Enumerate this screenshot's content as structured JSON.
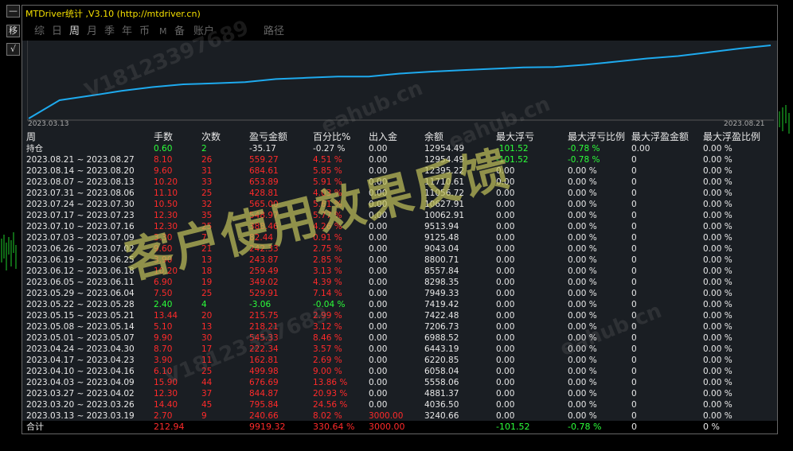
{
  "window": {
    "title": "MTDriver统计 ,V3.10 (http://mtdriver.cn)"
  },
  "side_buttons": [
    {
      "label": "—"
    },
    {
      "label": "移"
    },
    {
      "label": "√"
    }
  ],
  "tabs": [
    {
      "label": "综",
      "active": false
    },
    {
      "label": "日",
      "active": false
    },
    {
      "label": "周",
      "active": true
    },
    {
      "label": "月",
      "active": false
    },
    {
      "label": "季",
      "active": false
    },
    {
      "label": "年",
      "active": false
    },
    {
      "label": "币",
      "active": false
    },
    {
      "label": "M",
      "active": false
    },
    {
      "label": "备",
      "active": false
    },
    {
      "label": "账户",
      "active": false
    },
    {
      "label": "路径",
      "active": false
    }
  ],
  "equity_chart": {
    "start_date": "2023.03.13",
    "end_date": "2023.08.21",
    "line_color": "#1eaaee"
  },
  "table": {
    "headers": [
      "周",
      "手数",
      "次数",
      "盈亏金额",
      "百分比%",
      "出入金",
      "余额",
      "最大浮亏",
      "最大浮亏比例",
      "最大浮盈金额",
      "最大浮盈比例"
    ],
    "holding": [
      "持仓",
      "0.60",
      "2",
      "-35.17",
      "-0.27 %",
      "0.00",
      "12954.49",
      "-101.52",
      "-0.78 %",
      "0.00",
      "0.00 %"
    ],
    "rows": [
      [
        "2023.08.21 ~ 2023.08.27",
        "8.10",
        "26",
        "559.27",
        "4.51 %",
        "0.00",
        "12954.49",
        "-101.52",
        "-0.78 %",
        "0",
        "0.00 %"
      ],
      [
        "2023.08.14 ~ 2023.08.20",
        "9.60",
        "31",
        "684.61",
        "5.85 %",
        "0.00",
        "12395.22",
        "0.00",
        "0.00 %",
        "0",
        "0.00 %"
      ],
      [
        "2023.08.07 ~ 2023.08.13",
        "10.20",
        "33",
        "653.89",
        "5.91 %",
        "0.00",
        "11710.61",
        "0.00",
        "0.00 %",
        "0",
        "0.00 %"
      ],
      [
        "2023.07.31 ~ 2023.08.06",
        "11.10",
        "25",
        "428.81",
        "4.03 %",
        "0.00",
        "11056.72",
        "0.00",
        "0.00 %",
        "0",
        "0.00 %"
      ],
      [
        "2023.07.24 ~ 2023.07.30",
        "10.50",
        "32",
        "565.00",
        "5.61 %",
        "0.00",
        "10627.91",
        "0.00",
        "0.00 %",
        "0",
        "0.00 %"
      ],
      [
        "2023.07.17 ~ 2023.07.23",
        "12.30",
        "35",
        "548.97",
        "5.77 %",
        "0.00",
        "10062.91",
        "0.00",
        "0.00 %",
        "0",
        "0.00 %"
      ],
      [
        "2023.07.10 ~ 2023.07.16",
        "12.30",
        "25",
        "388.46",
        "4.26 %",
        "0.00",
        "9513.94",
        "0.00",
        "0.00 %",
        "0",
        "0.00 %"
      ],
      [
        "2023.07.03 ~ 2023.07.09",
        "3.30",
        "7",
        "82.44",
        "0.91 %",
        "0.00",
        "9125.48",
        "0.00",
        "0.00 %",
        "0",
        "0.00 %"
      ],
      [
        "2023.06.26 ~ 2023.07.02",
        "9.60",
        "21",
        "242.33",
        "2.75 %",
        "0.00",
        "9043.04",
        "0.00",
        "0.00 %",
        "0",
        "0.00 %"
      ],
      [
        "2023.06.19 ~ 2023.06.25",
        "3.90",
        "13",
        "243.87",
        "2.85 %",
        "0.00",
        "8800.71",
        "0.00",
        "0.00 %",
        "0",
        "0.00 %"
      ],
      [
        "2023.06.12 ~ 2023.06.18",
        "10.20",
        "18",
        "259.49",
        "3.13 %",
        "0.00",
        "8557.84",
        "0.00",
        "0.00 %",
        "0",
        "0.00 %"
      ],
      [
        "2023.06.05 ~ 2023.06.11",
        "6.90",
        "19",
        "349.02",
        "4.39 %",
        "0.00",
        "8298.35",
        "0.00",
        "0.00 %",
        "0",
        "0.00 %"
      ],
      [
        "2023.05.29 ~ 2023.06.04",
        "7.50",
        "25",
        "529.91",
        "7.14 %",
        "0.00",
        "7949.33",
        "0.00",
        "0.00 %",
        "0",
        "0.00 %"
      ],
      [
        "2023.05.22 ~ 2023.05.28",
        "2.40",
        "4",
        "-3.06",
        "-0.04 %",
        "0.00",
        "7419.42",
        "0.00",
        "0.00 %",
        "0",
        "0.00 %"
      ],
      [
        "2023.05.15 ~ 2023.05.21",
        "13.44",
        "20",
        "215.75",
        "2.99 %",
        "0.00",
        "7422.48",
        "0.00",
        "0.00 %",
        "0",
        "0.00 %"
      ],
      [
        "2023.05.08 ~ 2023.05.14",
        "5.10",
        "13",
        "218.21",
        "3.12 %",
        "0.00",
        "7206.73",
        "0.00",
        "0.00 %",
        "0",
        "0.00 %"
      ],
      [
        "2023.05.01 ~ 2023.05.07",
        "9.90",
        "30",
        "545.33",
        "8.46 %",
        "0.00",
        "6988.52",
        "0.00",
        "0.00 %",
        "0",
        "0.00 %"
      ],
      [
        "2023.04.24 ~ 2023.04.30",
        "8.70",
        "17",
        "222.34",
        "3.57 %",
        "0.00",
        "6443.19",
        "0.00",
        "0.00 %",
        "0",
        "0.00 %"
      ],
      [
        "2023.04.17 ~ 2023.04.23",
        "3.90",
        "11",
        "162.81",
        "2.69 %",
        "0.00",
        "6220.85",
        "0.00",
        "0.00 %",
        "0",
        "0.00 %"
      ],
      [
        "2023.04.10 ~ 2023.04.16",
        "6.10",
        "25",
        "499.98",
        "9.00 %",
        "0.00",
        "6058.04",
        "0.00",
        "0.00 %",
        "0",
        "0.00 %"
      ],
      [
        "2023.04.03 ~ 2023.04.09",
        "15.90",
        "44",
        "676.69",
        "13.86 %",
        "0.00",
        "5558.06",
        "0.00",
        "0.00 %",
        "0",
        "0.00 %"
      ],
      [
        "2023.03.27 ~ 2023.04.02",
        "12.30",
        "37",
        "844.87",
        "20.93 %",
        "0.00",
        "4881.37",
        "0.00",
        "0.00 %",
        "0",
        "0.00 %"
      ],
      [
        "2023.03.20 ~ 2023.03.26",
        "14.40",
        "45",
        "795.84",
        "24.56 %",
        "0.00",
        "4036.50",
        "0.00",
        "0.00 %",
        "0",
        "0.00 %"
      ],
      [
        "2023.03.13 ~ 2023.03.19",
        "2.70",
        "9",
        "240.66",
        "8.02 %",
        "3000.00",
        "3240.66",
        "0.00",
        "0.00 %",
        "0",
        "0.00 %"
      ]
    ],
    "total": [
      "合计",
      "212.94",
      "",
      "9919.32",
      "330.64 %",
      "3000.00",
      "",
      "-101.52",
      "-0.78 %",
      "0",
      "0 %"
    ]
  },
  "watermarks": {
    "main": "客户使用效果反馈",
    "site": "eahub.cn",
    "contact": "V18123397689"
  }
}
